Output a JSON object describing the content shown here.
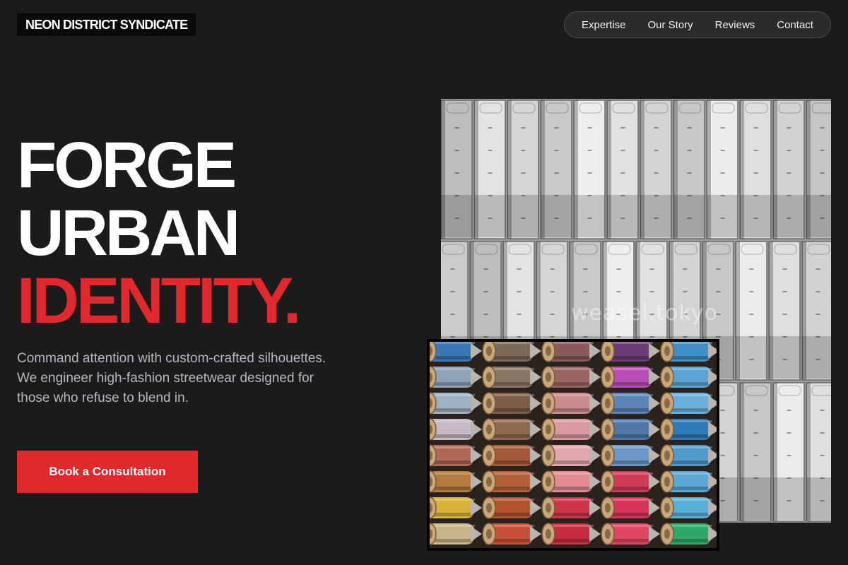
{
  "header": {
    "brand": "NEON DISTRICT SYNDICATE",
    "nav": [
      {
        "label": "Expertise"
      },
      {
        "label": "Our Story"
      },
      {
        "label": "Reviews"
      },
      {
        "label": "Contact"
      }
    ]
  },
  "hero": {
    "headline_line1": "FORGE",
    "headline_line2": "URBAN",
    "headline_line3": "IDENTITY.",
    "description": "Command attention with custom-crafted silhouettes. We engineer high-fashion streetwear designed for those who refuse to blend in.",
    "cta_label": "Book a Consultation"
  },
  "media": {
    "photo_watermark": "weasel.tokyo"
  },
  "colors": {
    "background": "#1b1b1b",
    "accent": "#e0282d",
    "text_muted": "#b4b8c0"
  }
}
